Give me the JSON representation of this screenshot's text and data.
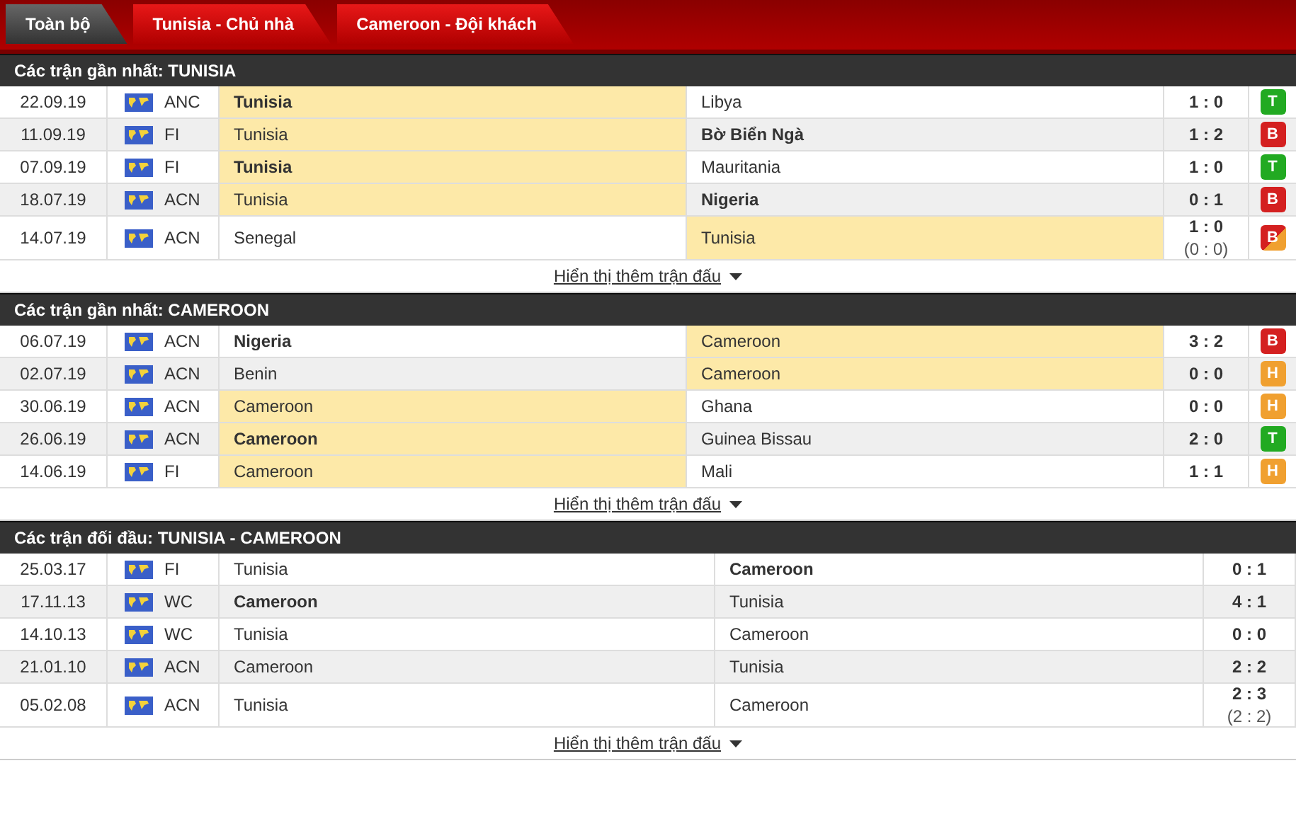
{
  "tabs": [
    {
      "label": "Toàn bộ",
      "selected": true
    },
    {
      "label": "Tunisia - Chủ nhà",
      "selected": false
    },
    {
      "label": "Cameroon - Đội khách",
      "selected": false
    }
  ],
  "sections": [
    {
      "title": "Các trận gần nhất: TUNISIA",
      "show_more": "Hiển thị thêm trận đấu",
      "matches": [
        {
          "date": "22.09.19",
          "league": "ANC",
          "home": {
            "name": "Tunisia",
            "bold": true,
            "highlight": true
          },
          "away": {
            "name": "Libya",
            "bold": false,
            "highlight": false
          },
          "score": "1 : 0",
          "result": {
            "label": "T",
            "kind": "win"
          }
        },
        {
          "date": "11.09.19",
          "league": "FI",
          "home": {
            "name": "Tunisia",
            "bold": false,
            "highlight": true
          },
          "away": {
            "name": "Bờ Biển Ngà",
            "bold": true,
            "highlight": false
          },
          "score": "1 : 2",
          "result": {
            "label": "B",
            "kind": "loss"
          }
        },
        {
          "date": "07.09.19",
          "league": "FI",
          "home": {
            "name": "Tunisia",
            "bold": true,
            "highlight": true
          },
          "away": {
            "name": "Mauritania",
            "bold": false,
            "highlight": false
          },
          "score": "1 : 0",
          "result": {
            "label": "T",
            "kind": "win"
          }
        },
        {
          "date": "18.07.19",
          "league": "ACN",
          "home": {
            "name": "Tunisia",
            "bold": false,
            "highlight": true
          },
          "away": {
            "name": "Nigeria",
            "bold": true,
            "highlight": false
          },
          "score": "0 : 1",
          "result": {
            "label": "B",
            "kind": "loss"
          }
        },
        {
          "date": "14.07.19",
          "league": "ACN",
          "home": {
            "name": "Senegal",
            "bold": false,
            "highlight": false
          },
          "away": {
            "name": "Tunisia",
            "bold": false,
            "highlight": true
          },
          "score": "1 : 0",
          "halftime": "(0 : 0)",
          "result": {
            "label": "B",
            "kind": "loss-draw"
          }
        }
      ]
    },
    {
      "title": "Các trận gần nhất: CAMEROON",
      "show_more": "Hiển thị thêm trận đấu",
      "matches": [
        {
          "date": "06.07.19",
          "league": "ACN",
          "home": {
            "name": "Nigeria",
            "bold": true,
            "highlight": false
          },
          "away": {
            "name": "Cameroon",
            "bold": false,
            "highlight": true
          },
          "score": "3 : 2",
          "result": {
            "label": "B",
            "kind": "loss"
          }
        },
        {
          "date": "02.07.19",
          "league": "ACN",
          "home": {
            "name": "Benin",
            "bold": false,
            "highlight": false
          },
          "away": {
            "name": "Cameroon",
            "bold": false,
            "highlight": true
          },
          "score": "0 : 0",
          "result": {
            "label": "H",
            "kind": "draw"
          }
        },
        {
          "date": "30.06.19",
          "league": "ACN",
          "home": {
            "name": "Cameroon",
            "bold": false,
            "highlight": true
          },
          "away": {
            "name": "Ghana",
            "bold": false,
            "highlight": false
          },
          "score": "0 : 0",
          "result": {
            "label": "H",
            "kind": "draw"
          }
        },
        {
          "date": "26.06.19",
          "league": "ACN",
          "home": {
            "name": "Cameroon",
            "bold": true,
            "highlight": true
          },
          "away": {
            "name": "Guinea Bissau",
            "bold": false,
            "highlight": false
          },
          "score": "2 : 0",
          "result": {
            "label": "T",
            "kind": "win"
          }
        },
        {
          "date": "14.06.19",
          "league": "FI",
          "home": {
            "name": "Cameroon",
            "bold": false,
            "highlight": true
          },
          "away": {
            "name": "Mali",
            "bold": false,
            "highlight": false
          },
          "score": "1 : 1",
          "result": {
            "label": "H",
            "kind": "draw"
          }
        }
      ]
    },
    {
      "title": "Các trận đối đầu: TUNISIA - CAMEROON",
      "show_more": "Hiển thị thêm trận đấu",
      "matches": [
        {
          "date": "25.03.17",
          "league": "FI",
          "home": {
            "name": "Tunisia",
            "bold": false,
            "highlight": false
          },
          "away": {
            "name": "Cameroon",
            "bold": true,
            "highlight": false
          },
          "score": "0 : 1"
        },
        {
          "date": "17.11.13",
          "league": "WC",
          "home": {
            "name": "Cameroon",
            "bold": true,
            "highlight": false
          },
          "away": {
            "name": "Tunisia",
            "bold": false,
            "highlight": false
          },
          "score": "4 : 1"
        },
        {
          "date": "14.10.13",
          "league": "WC",
          "home": {
            "name": "Tunisia",
            "bold": false,
            "highlight": false
          },
          "away": {
            "name": "Cameroon",
            "bold": false,
            "highlight": false
          },
          "score": "0 : 0"
        },
        {
          "date": "21.01.10",
          "league": "ACN",
          "home": {
            "name": "Cameroon",
            "bold": false,
            "highlight": false
          },
          "away": {
            "name": "Tunisia",
            "bold": false,
            "highlight": false
          },
          "score": "2 : 2"
        },
        {
          "date": "05.02.08",
          "league": "ACN",
          "home": {
            "name": "Tunisia",
            "bold": false,
            "highlight": false
          },
          "away": {
            "name": "Cameroon",
            "bold": false,
            "highlight": false
          },
          "score": "2 : 3",
          "halftime": "(2 : 2)"
        }
      ]
    }
  ]
}
